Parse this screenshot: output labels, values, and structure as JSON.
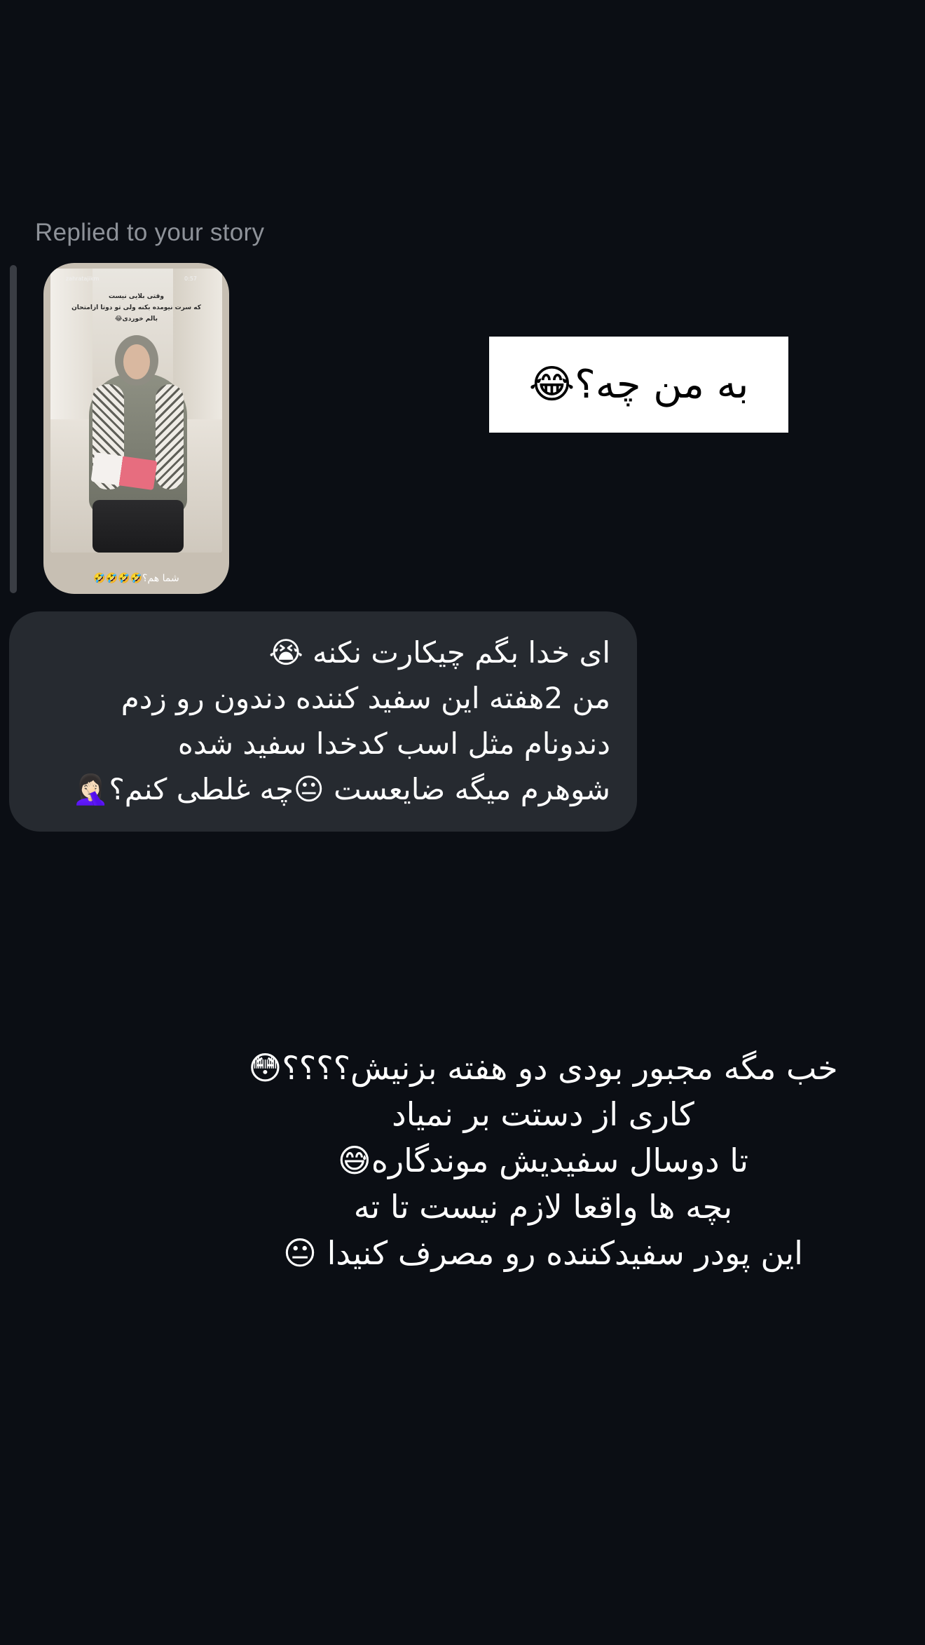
{
  "reply_header": {
    "label": "Replied to your story"
  },
  "story_preview": {
    "username": "zahratajikm",
    "time": "0:57",
    "caption_top": [
      "وقتی بلایی نیست",
      "که سرت نیومده بکنه ولی تو دوتا ازامتحان",
      "بالم خوردی😂"
    ],
    "caption_bottom": "شما هم؟🤣🤣🤣🤣",
    "sticker_text": "به من چه؟😂"
  },
  "message": {
    "lines": [
      "ای خدا بگم چیکارت نکنه 😭",
      "من 2هفته این سفید کننده دندون رو زدم",
      "دندونام مثل اسب کدخدا سفید شده",
      "شوهرم میگه ضایعست 😐چه غلطی کنم؟🤦🏻‍♀️"
    ]
  },
  "overlay": {
    "lines": [
      "خب مگه مجبور بودی دو هفته بزنیش؟؟؟؟😳",
      "کاری از دستت بر نمیاد",
      "تا دوسال سفیدیش موندگاره😅",
      "بچه ها واقعا لازم نیست تا ته",
      "این پودر سفیدکننده رو مصرف کنیدا 😐"
    ]
  },
  "colors": {
    "background": "#0b0e14",
    "bubble": "#262a30",
    "muted_text": "#8e9299",
    "sticker_bg": "#ffffff"
  }
}
